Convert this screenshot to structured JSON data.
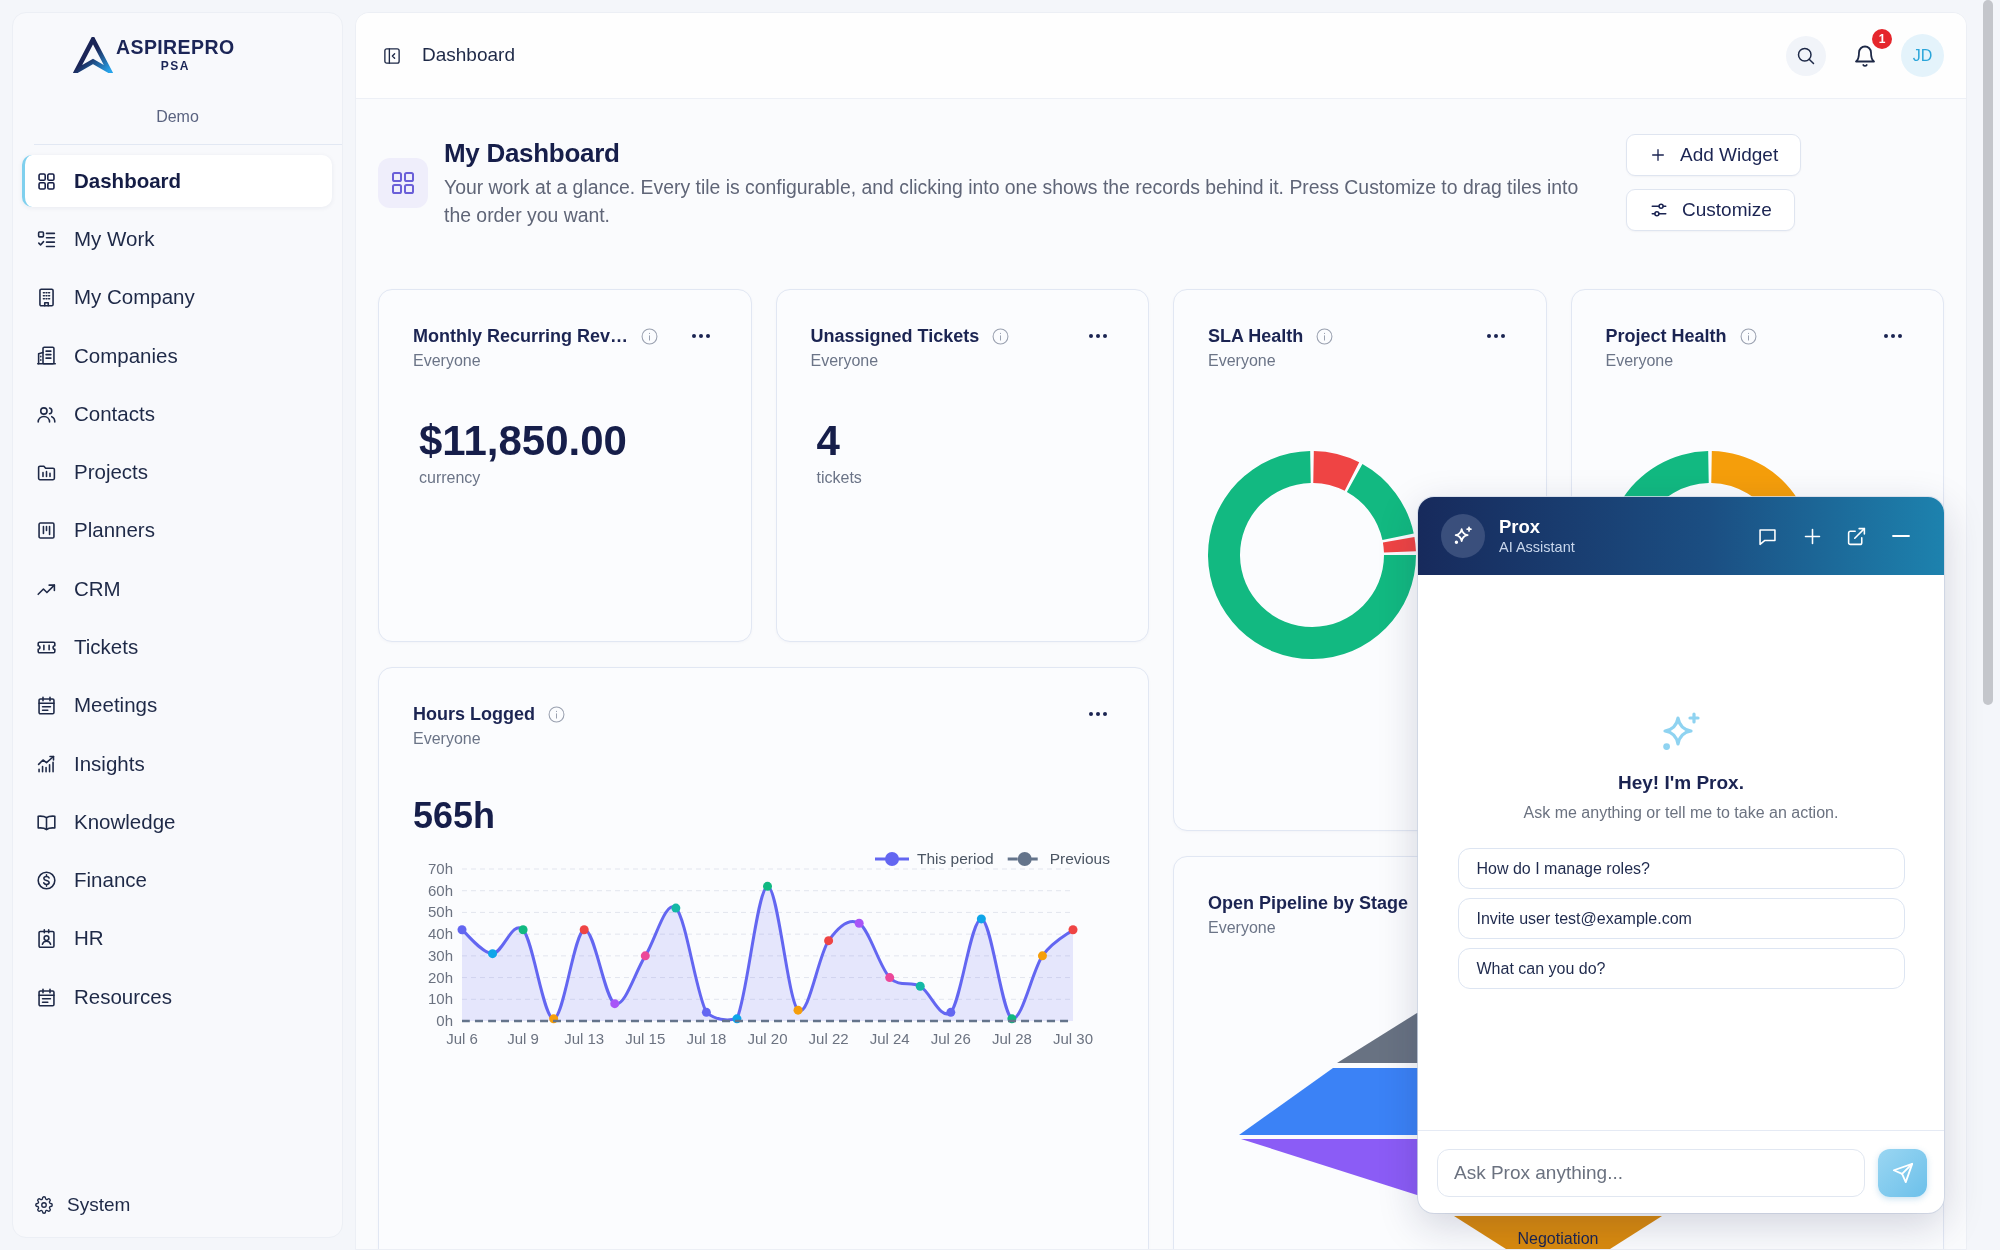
{
  "sidebar": {
    "logo": {
      "name": "ASPIREPRO",
      "tagline": "PSA"
    },
    "workspace": "Demo",
    "items": [
      {
        "label": "Dashboard",
        "selected": true
      },
      {
        "label": "My Work",
        "selected": false
      },
      {
        "label": "My Company",
        "selected": false
      },
      {
        "label": "Companies",
        "selected": false
      },
      {
        "label": "Contacts",
        "selected": false
      },
      {
        "label": "Projects",
        "selected": false
      },
      {
        "label": "Planners",
        "selected": false
      },
      {
        "label": "CRM",
        "selected": false
      },
      {
        "label": "Tickets",
        "selected": false
      },
      {
        "label": "Meetings",
        "selected": false
      },
      {
        "label": "Insights",
        "selected": false
      },
      {
        "label": "Knowledge",
        "selected": false
      },
      {
        "label": "Finance",
        "selected": false
      },
      {
        "label": "HR",
        "selected": false
      },
      {
        "label": "Resources",
        "selected": false
      }
    ],
    "footer_item": {
      "label": "System"
    }
  },
  "header": {
    "title": "Dashboard",
    "notification_count": "1",
    "avatar_initials": "JD"
  },
  "page": {
    "title": "My Dashboard",
    "description": "Your work at a glance. Every tile is configurable, and clicking into one shows the records behind it. Press Customize to drag tiles into the order you want.",
    "actions": [
      {
        "label": "Add Widget"
      },
      {
        "label": "Customize"
      }
    ]
  },
  "widgets": [
    {
      "kind": "metric",
      "title": "Monthly Recurring Rev…",
      "audience": "Everyone",
      "value": "$11,850.00",
      "unit": "currency"
    },
    {
      "kind": "metric",
      "title": "Unassigned Tickets",
      "audience": "Everyone",
      "value": "4",
      "unit": "tickets"
    },
    {
      "kind": "donut",
      "title": "SLA Health",
      "audience": "Everyone"
    },
    {
      "kind": "donut",
      "title": "Project Health",
      "audience": "Everyone"
    },
    {
      "kind": "line",
      "title": "Hours Logged",
      "audience": "Everyone",
      "value": "565h",
      "chart_data": {
        "type": "line",
        "grid": true,
        "legend": true,
        "categories": [
          "Jul 6",
          null,
          "Jul 9",
          null,
          "Jul 13",
          null,
          "Jul 15",
          null,
          "Jul 18",
          null,
          "Jul 20",
          null,
          "Jul 22",
          null,
          "Jul 24",
          null,
          "Jul 26",
          null,
          "Jul 28",
          null,
          "Jul 30"
        ],
        "ylim": [
          0,
          70
        ],
        "yticks": [
          {
            "value": 0,
            "label": "0h"
          },
          {
            "value": 10,
            "label": "10h"
          },
          {
            "value": 20,
            "label": "20h"
          },
          {
            "value": 30,
            "label": "30h"
          },
          {
            "value": 40,
            "label": "40h"
          },
          {
            "value": 50,
            "label": "50h"
          },
          {
            "value": 60,
            "label": "60h"
          },
          {
            "value": 70,
            "label": "70h"
          }
        ],
        "series": [
          {
            "name": "This period",
            "color": "#6366f1",
            "type": "area",
            "marker": "circle",
            "values": [
              42,
              31,
              42,
              1,
              42,
              8,
              30,
              52,
              4,
              1,
              62,
              5,
              37,
              45,
              20,
              16,
              4,
              47,
              1,
              30,
              42
            ]
          },
          {
            "name": "Previous",
            "color": "#64748b",
            "line_style": "dashed",
            "values": [
              0,
              0,
              0,
              0,
              0,
              0,
              0,
              0,
              0,
              0,
              0,
              0,
              0,
              0,
              0,
              0,
              0,
              0,
              0,
              0,
              0
            ]
          }
        ]
      }
    },
    {
      "kind": "funnel",
      "title": "Open Pipeline by Stage",
      "audience": "Everyone",
      "stage_label": "Negotiation"
    }
  ],
  "assistant": {
    "name": "Prox",
    "role": "AI Assistant",
    "greeting": "Hey! I'm Prox.",
    "hint": "Ask me anything or tell me to take an action.",
    "suggestions": [
      {
        "label": "How do I manage roles?"
      },
      {
        "label": "Invite user test@example.com"
      },
      {
        "label": "What can you do?"
      }
    ],
    "composer": {
      "placeholder": "Ask Prox anything..."
    }
  }
}
